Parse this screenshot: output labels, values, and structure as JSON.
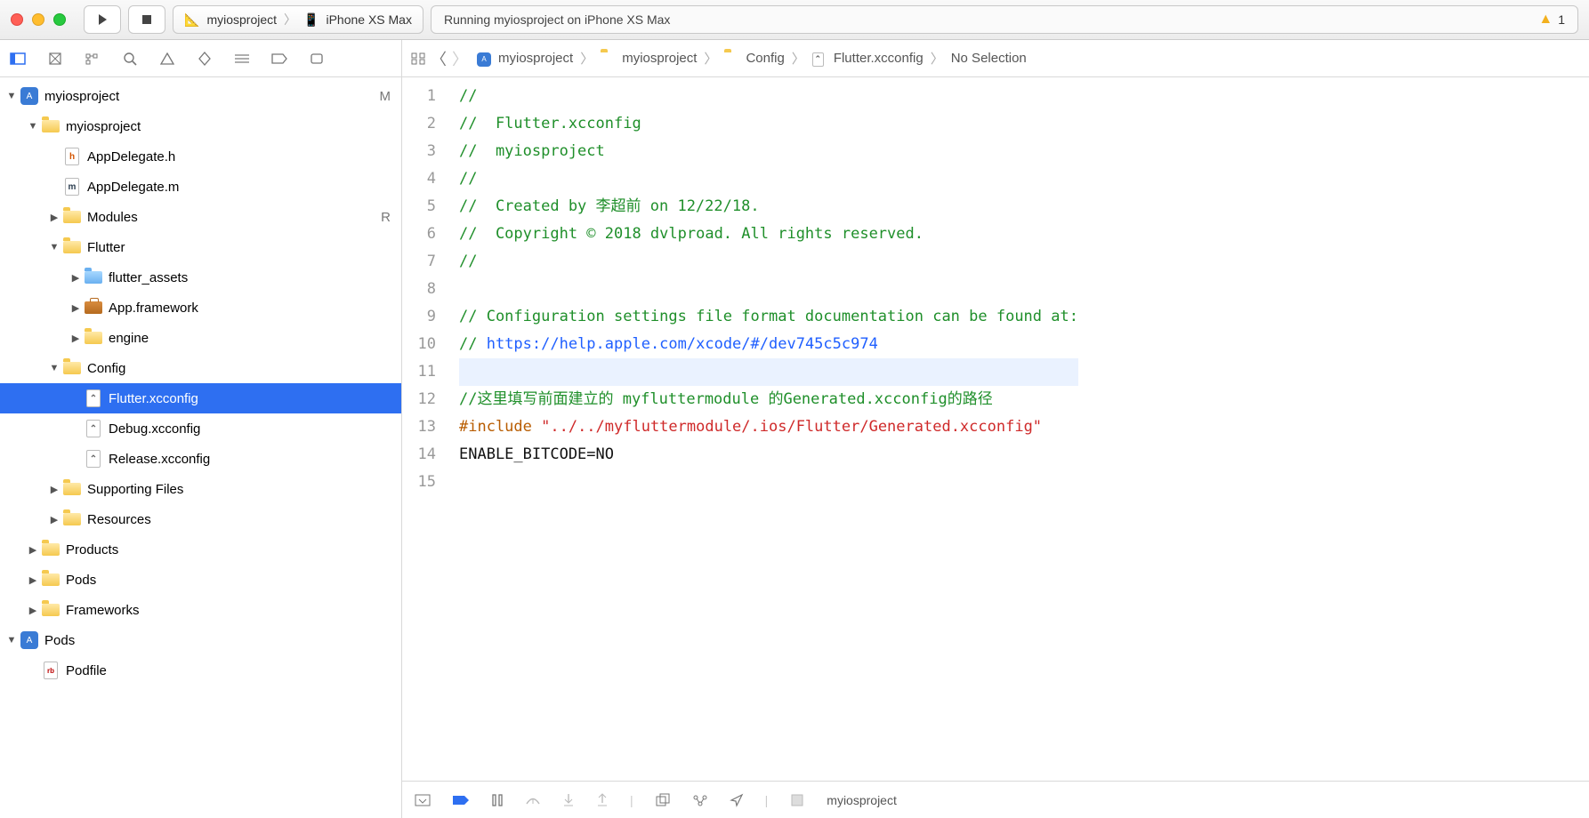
{
  "toolbar": {
    "scheme_app": "myiosproject",
    "scheme_device": "iPhone XS Max",
    "status_text": "Running myiosproject on iPhone XS Max",
    "warning_count": "1"
  },
  "tree": [
    {
      "indent": 0,
      "disclose": "down",
      "icon": "proj",
      "label": "myiosproject",
      "tag": "M"
    },
    {
      "indent": 1,
      "disclose": "down",
      "icon": "folder",
      "label": "myiosproject"
    },
    {
      "indent": 2,
      "disclose": "",
      "icon": "file-h",
      "label": "AppDelegate.h"
    },
    {
      "indent": 2,
      "disclose": "",
      "icon": "file-m",
      "label": "AppDelegate.m"
    },
    {
      "indent": 2,
      "disclose": "right",
      "icon": "folder",
      "label": "Modules",
      "tag": "R"
    },
    {
      "indent": 2,
      "disclose": "down",
      "icon": "folder",
      "label": "Flutter"
    },
    {
      "indent": 3,
      "disclose": "right",
      "icon": "folder-blue",
      "label": "flutter_assets"
    },
    {
      "indent": 3,
      "disclose": "right",
      "icon": "toolbox",
      "label": "App.framework"
    },
    {
      "indent": 3,
      "disclose": "right",
      "icon": "folder",
      "label": "engine"
    },
    {
      "indent": 2,
      "disclose": "down",
      "icon": "folder",
      "label": "Config"
    },
    {
      "indent": 3,
      "disclose": "",
      "icon": "file-cfg",
      "label": "Flutter.xcconfig",
      "selected": true
    },
    {
      "indent": 3,
      "disclose": "",
      "icon": "file-cfg",
      "label": "Debug.xcconfig"
    },
    {
      "indent": 3,
      "disclose": "",
      "icon": "file-cfg",
      "label": "Release.xcconfig"
    },
    {
      "indent": 2,
      "disclose": "right",
      "icon": "folder",
      "label": "Supporting Files"
    },
    {
      "indent": 2,
      "disclose": "right",
      "icon": "folder",
      "label": "Resources"
    },
    {
      "indent": 1,
      "disclose": "right",
      "icon": "folder",
      "label": "Products"
    },
    {
      "indent": 1,
      "disclose": "right",
      "icon": "folder",
      "label": "Pods"
    },
    {
      "indent": 1,
      "disclose": "right",
      "icon": "folder",
      "label": "Frameworks"
    },
    {
      "indent": 0,
      "disclose": "down",
      "icon": "proj",
      "label": "Pods"
    },
    {
      "indent": 1,
      "disclose": "",
      "icon": "file-rb",
      "label": "Podfile"
    }
  ],
  "breadcrumbs": [
    {
      "icon": "proj",
      "label": "myiosproject"
    },
    {
      "icon": "folder",
      "label": "myiosproject"
    },
    {
      "icon": "folder",
      "label": "Config"
    },
    {
      "icon": "file-cfg",
      "label": "Flutter.xcconfig"
    },
    {
      "icon": "",
      "label": "No Selection"
    }
  ],
  "code_lines": [
    {
      "n": 1,
      "tokens": [
        {
          "cls": "c-cmt",
          "t": "//"
        }
      ]
    },
    {
      "n": 2,
      "tokens": [
        {
          "cls": "c-cmt",
          "t": "//  Flutter.xcconfig"
        }
      ]
    },
    {
      "n": 3,
      "tokens": [
        {
          "cls": "c-cmt",
          "t": "//  myiosproject"
        }
      ]
    },
    {
      "n": 4,
      "tokens": [
        {
          "cls": "c-cmt",
          "t": "//"
        }
      ]
    },
    {
      "n": 5,
      "tokens": [
        {
          "cls": "c-cmt",
          "t": "//  Created by 李超前 on 12/22/18."
        }
      ]
    },
    {
      "n": 6,
      "tokens": [
        {
          "cls": "c-cmt",
          "t": "//  Copyright © 2018 dvlproad. All rights reserved."
        }
      ]
    },
    {
      "n": 7,
      "tokens": [
        {
          "cls": "c-cmt",
          "t": "//"
        }
      ]
    },
    {
      "n": 8,
      "tokens": [
        {
          "cls": "",
          "t": ""
        }
      ]
    },
    {
      "n": 9,
      "tokens": [
        {
          "cls": "c-cmt",
          "t": "// Configuration settings file format documentation can be found at:"
        }
      ]
    },
    {
      "n": 10,
      "tokens": [
        {
          "cls": "c-cmt",
          "t": "// "
        },
        {
          "cls": "c-url",
          "t": "https://help.apple.com/xcode/#/dev745c5c974"
        }
      ]
    },
    {
      "n": 11,
      "hl": true,
      "tokens": [
        {
          "cls": "",
          "t": ""
        }
      ]
    },
    {
      "n": 12,
      "tokens": [
        {
          "cls": "c-cmt",
          "t": "//这里填写前面建立的 myfluttermodule 的Generated.xcconfig的路径"
        }
      ]
    },
    {
      "n": 13,
      "tokens": [
        {
          "cls": "c-pp",
          "t": "#include "
        },
        {
          "cls": "c-str",
          "t": "\"../../myfluttermodule/.ios/Flutter/Generated.xcconfig\""
        }
      ]
    },
    {
      "n": 14,
      "tokens": [
        {
          "cls": "c-plain",
          "t": "ENABLE_BITCODE=NO"
        }
      ]
    },
    {
      "n": 15,
      "tokens": [
        {
          "cls": "",
          "t": ""
        }
      ]
    }
  ],
  "bottom": {
    "project_label": "myiosproject"
  }
}
